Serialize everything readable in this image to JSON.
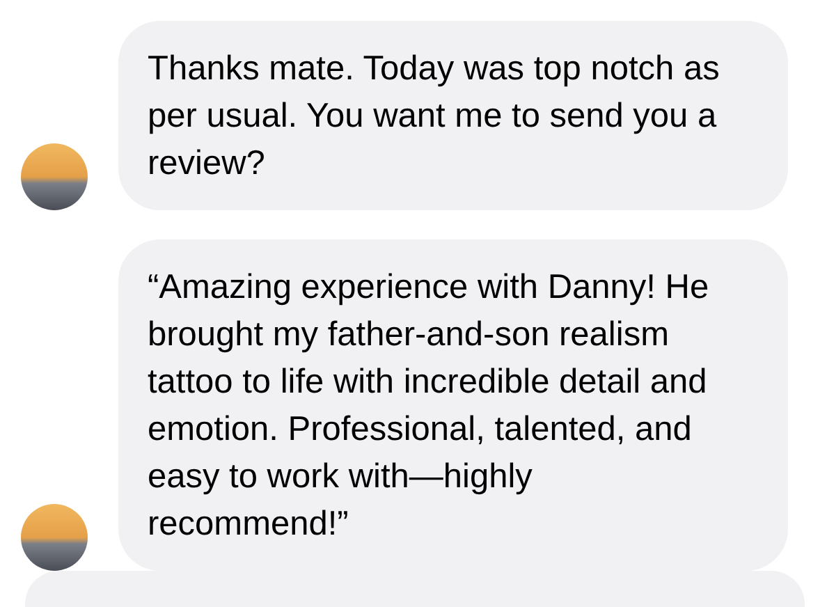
{
  "messages": [
    {
      "text": "Thanks mate. Today was top notch as per usual. You want me to send you a review?"
    },
    {
      "text": "“Amazing experience with Danny! He brought my father-and-son realism tattoo to life with incredible detail and emotion. Professional, talented, and easy to work with—highly recommend!”"
    }
  ]
}
